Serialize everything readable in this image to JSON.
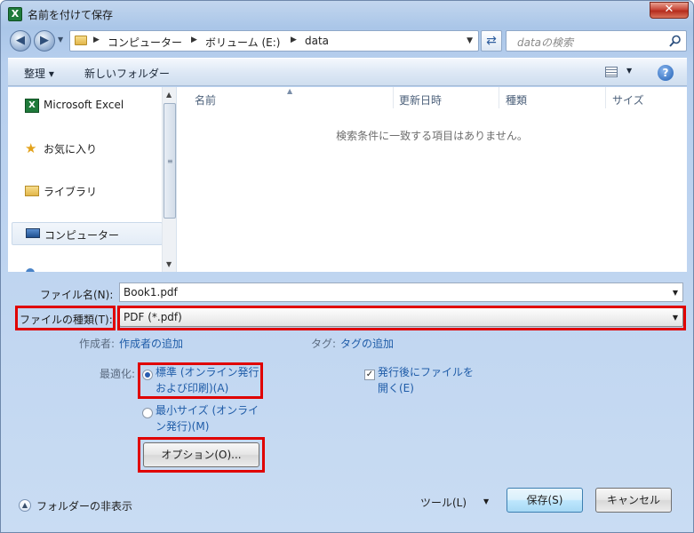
{
  "window": {
    "title": "名前を付けて保存",
    "close_label": "✕",
    "app_icon_letter": "X"
  },
  "address": {
    "crumbs": [
      "コンピューター",
      "ボリューム (E:)",
      "data"
    ],
    "search_placeholder": "dataの検索"
  },
  "toolbar": {
    "organize": "整理 ▾",
    "new_folder": "新しいフォルダー",
    "help": "?"
  },
  "nav": {
    "items": [
      {
        "label": "Microsoft Excel",
        "icon": "excel-icon"
      },
      {
        "label": "お気に入り",
        "icon": "star-icon"
      },
      {
        "label": "ライブラリ",
        "icon": "library-icon"
      },
      {
        "label": "コンピューター",
        "icon": "computer-icon",
        "selected": true
      }
    ]
  },
  "files": {
    "columns": [
      "名前",
      "更新日時",
      "種類",
      "サイズ"
    ],
    "empty_message": "検索条件に一致する項目はありません。"
  },
  "form": {
    "filename_label": "ファイル名(N):",
    "filename_value": "Book1.pdf",
    "filetype_label": "ファイルの種類(T):",
    "filetype_value": "PDF (*.pdf)",
    "author_label": "作成者:",
    "author_link": "作成者の追加",
    "tags_label": "タグ:",
    "tags_link": "タグの追加",
    "optimize_label": "最適化:",
    "opt_standard_line1": "標準 (オンライン発行",
    "opt_standard_line2": "および印刷)(A)",
    "opt_minimum_line1": "最小サイズ (オンライ",
    "opt_minimum_line2": "ン発行)(M)",
    "open_after_line1": "発行後にファイルを",
    "open_after_line2": "開く(E)",
    "options_button": "オプション(O)...",
    "hide_folders": "フォルダーの非表示",
    "tools": "ツール(L)",
    "save": "保存(S)",
    "cancel": "キャンセル"
  },
  "state": {
    "optimize": "standard",
    "open_after_publish": true
  },
  "colors": {
    "highlight": "#e00000",
    "link": "#1f5ca8"
  }
}
